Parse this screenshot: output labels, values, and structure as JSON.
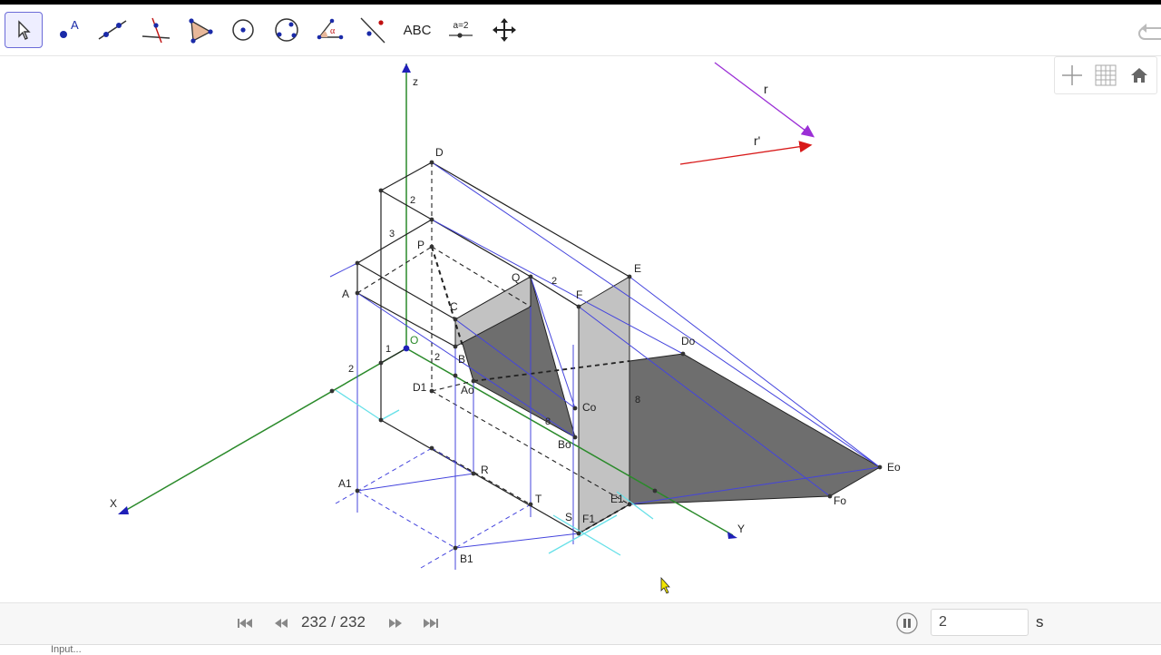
{
  "toolbar": {
    "tools": [
      {
        "name": "move-tool",
        "label": ""
      },
      {
        "name": "point-tool",
        "label": "A"
      },
      {
        "name": "line-tool",
        "label": ""
      },
      {
        "name": "perpendicular-line-tool",
        "label": ""
      },
      {
        "name": "polygon-tool",
        "label": ""
      },
      {
        "name": "circle-center-point-tool",
        "label": ""
      },
      {
        "name": "circle-three-points-tool",
        "label": ""
      },
      {
        "name": "angle-tool",
        "label": "α"
      },
      {
        "name": "reflect-tool",
        "label": ""
      },
      {
        "name": "text-tool",
        "label": "ABC"
      },
      {
        "name": "slider-tool",
        "label": "a=2"
      },
      {
        "name": "move-graphics-view-tool",
        "label": ""
      }
    ]
  },
  "style_bar": {
    "icons": [
      "axes-icon",
      "grid-icon",
      "home-icon"
    ]
  },
  "construction": {
    "labels": {
      "z": "z",
      "x": "X",
      "y": "Y",
      "r": "r",
      "r_prime": "r'",
      "D": "D",
      "A": "A",
      "P": "P",
      "Q": "Q",
      "C": "C",
      "B": "B",
      "E": "E",
      "F": "F",
      "O": "O",
      "D1": "D1",
      "Ao": "Ao",
      "Co": "Co",
      "Bo": "Bo",
      "Do": "Do",
      "Eo": "Eo",
      "Fo": "Fo",
      "E1": "E1",
      "F1": "F1",
      "A1": "A1",
      "B1": "B1",
      "R": "R",
      "T": "T",
      "S": "S",
      "dim_2_top": "2",
      "dim_3": "3",
      "dim_2_q": "2",
      "dim_1": "1",
      "dim_2_left": "2",
      "dim_2_mid": "2",
      "dim_8_right": "8",
      "dim_8_low": "8"
    }
  },
  "playbar": {
    "counter": "232 / 232",
    "speed_value": "2",
    "speed_unit": "s"
  },
  "input_bar": {
    "text": "Input..."
  },
  "colors": {
    "axis_green": "#2a8a2a",
    "axis_blue": "#1f1fb8",
    "helper_blue": "#4444dd",
    "shadow_dark": "#6e6e6e",
    "face_light": "#c2c2c2",
    "cyan": "#66e0e8",
    "ray_purple": "#9b2fd6",
    "ray_red": "#d81818"
  }
}
